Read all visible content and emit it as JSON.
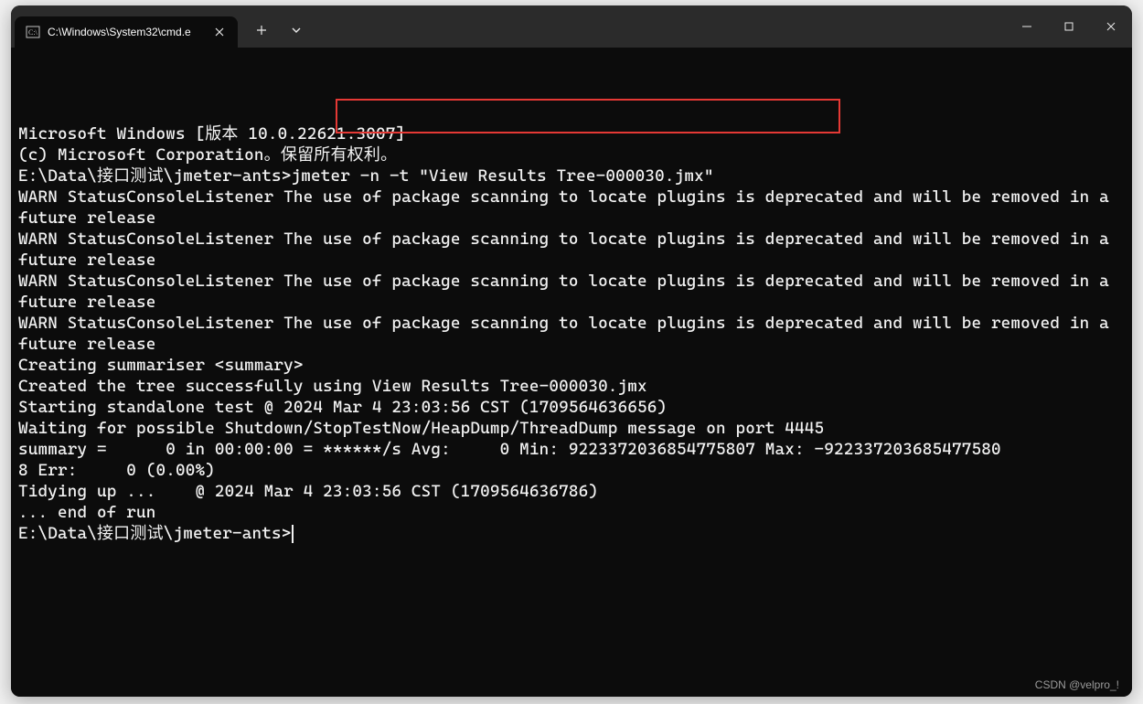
{
  "titlebar": {
    "tab_title": "C:\\Windows\\System32\\cmd.e"
  },
  "terminal": {
    "lines": [
      "Microsoft Windows [版本 10.0.22621.3007]",
      "(c) Microsoft Corporation。保留所有权利。",
      "",
      "E:\\Data\\接口测试\\jmeter-ants>jmeter -n -t \"View Results Tree-000030.jmx\"",
      "WARN StatusConsoleListener The use of package scanning to locate plugins is deprecated and will be removed in a future release",
      "WARN StatusConsoleListener The use of package scanning to locate plugins is deprecated and will be removed in a future release",
      "WARN StatusConsoleListener The use of package scanning to locate plugins is deprecated and will be removed in a future release",
      "WARN StatusConsoleListener The use of package scanning to locate plugins is deprecated and will be removed in a future release",
      "Creating summariser <summary>",
      "Created the tree successfully using View Results Tree-000030.jmx",
      "Starting standalone test @ 2024 Mar 4 23:03:56 CST (1709564636656)",
      "Waiting for possible Shutdown/StopTestNow/HeapDump/ThreadDump message on port 4445",
      "summary =      0 in 00:00:00 = ******/s Avg:     0 Min: 9223372036854775807 Max: -922337203685477580",
      "8 Err:     0 (0.00%)",
      "Tidying up ...    @ 2024 Mar 4 23:03:56 CST (1709564636786)",
      "... end of run",
      "",
      "E:\\Data\\接口测试\\jmeter-ants>"
    ],
    "prompt_has_cursor_on_line_index": 17
  },
  "highlight": {
    "target_text": "jmeter -n -t \"View Results Tree-000030.jmx\""
  },
  "watermark": "CSDN @velpro_!"
}
